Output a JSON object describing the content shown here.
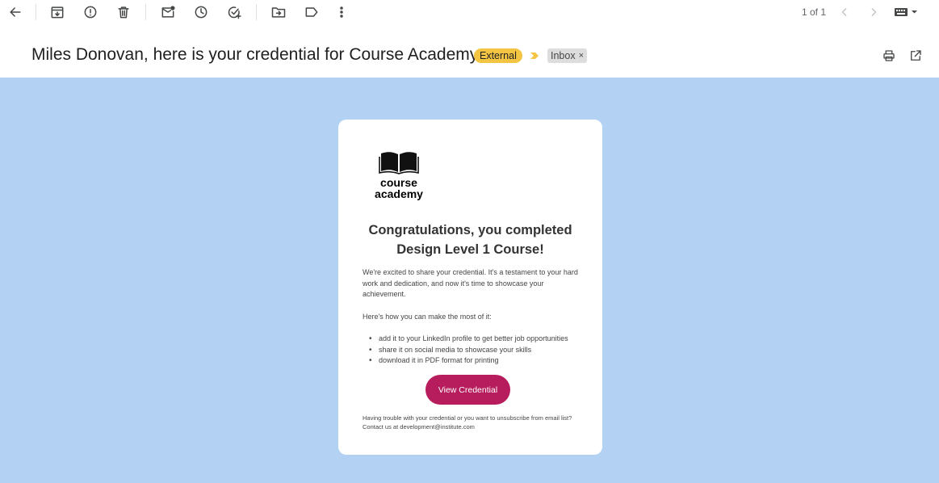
{
  "toolbar": {
    "actions": [
      "back",
      "archive",
      "report-spam",
      "delete",
      "mark-unread",
      "snooze",
      "add-to-tasks",
      "move-to",
      "labels",
      "more"
    ],
    "pager": "1 of 1"
  },
  "email": {
    "subject": "Miles Donovan, here is your credential for Course Academy",
    "external_label": "External",
    "inbox_label": "Inbox",
    "inbox_remove": "×"
  },
  "content": {
    "brand_line1": "course",
    "brand_line2": "academy",
    "headline_line1": "Congratulations, you completed",
    "headline_line2": "Design Level 1 Course!",
    "intro": "We're excited to share your credential. It's a testament to your hard work and dedication, and now it's time to showcase your achievement.",
    "tips_intro": "Here's how you can make the most of it:",
    "tips": [
      "add it to your LinkedIn profile to get better job opportunities",
      "share it on social media to showcase your skills",
      "download it in PDF format for printing"
    ],
    "cta_label": "View Credential",
    "footer": "Having trouble with your credential or you want to unsubscribe from email list? Contact us at  development@institute.com"
  },
  "colors": {
    "body_background": "#b3d1f3",
    "cta": "#b71d5c",
    "external_chip": "#f4c542"
  }
}
